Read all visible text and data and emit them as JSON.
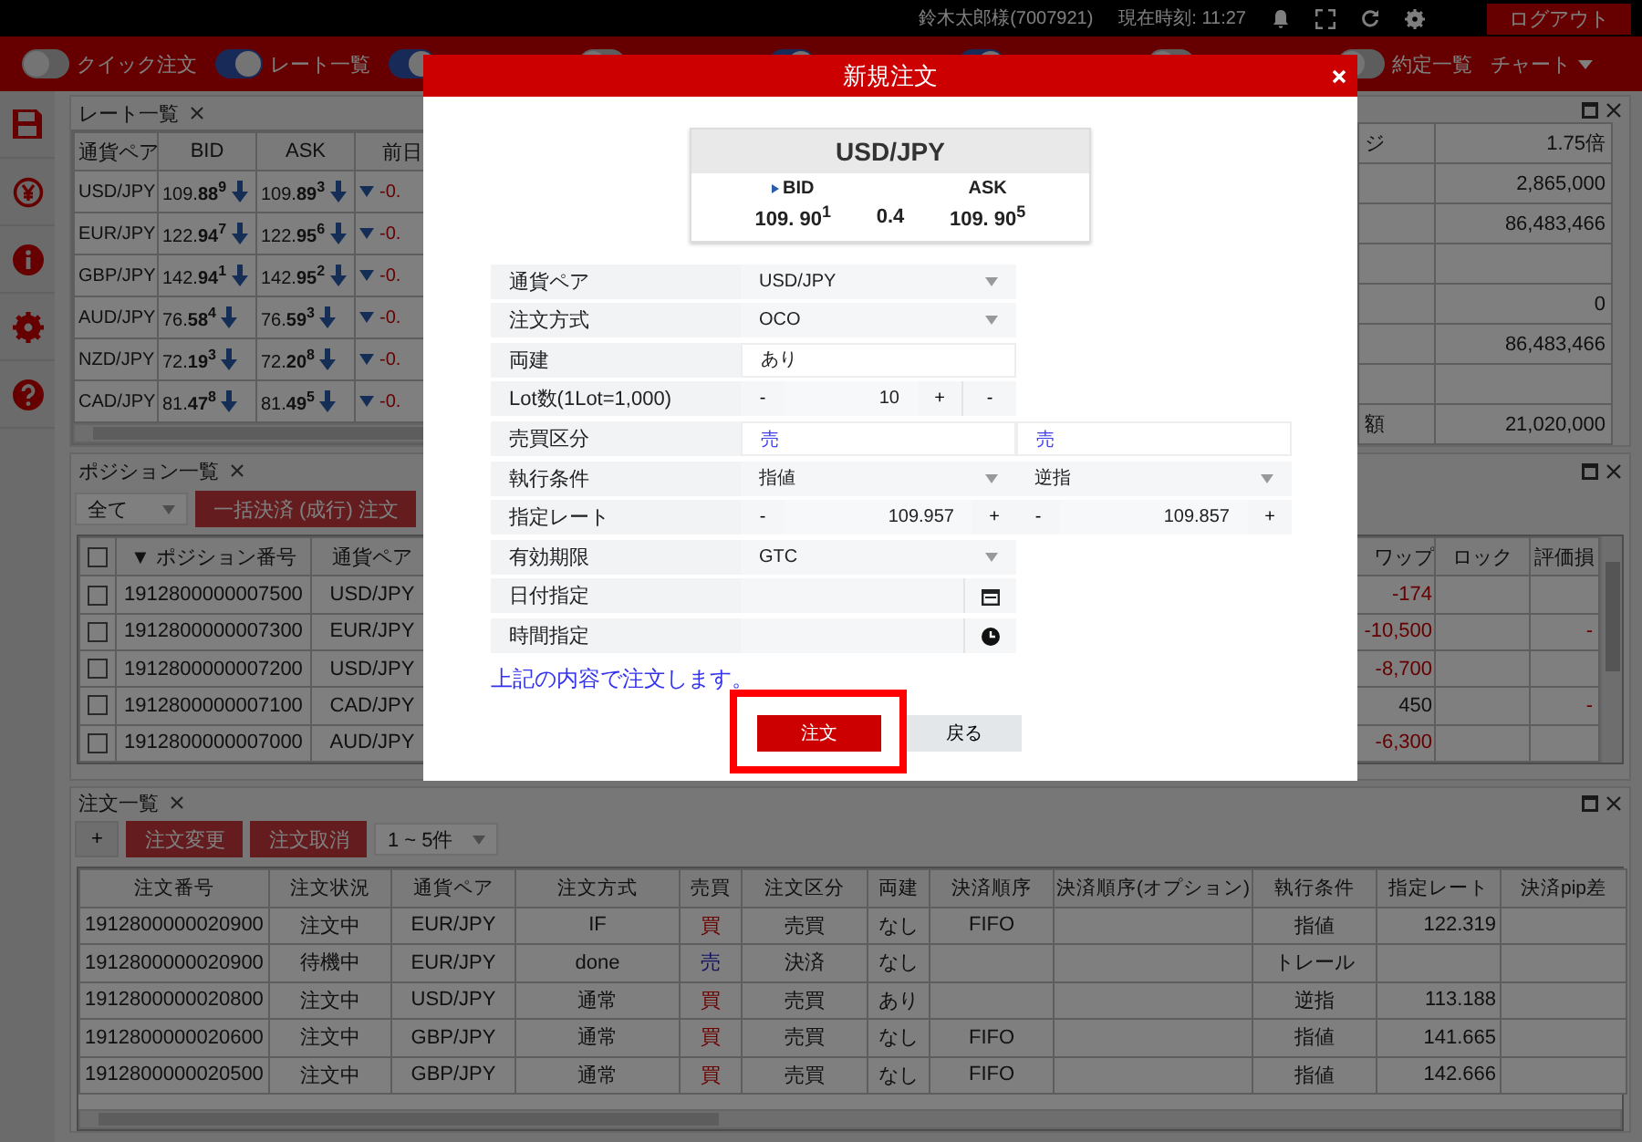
{
  "top_bar": {
    "user": "鈴木太郎様(7007921)",
    "time": "現在時刻: 11:27",
    "logout": "ログアウト"
  },
  "toolbar": {
    "toggles": [
      {
        "label": "クイック注文",
        "on": false
      },
      {
        "label": "レート一覧",
        "on": true
      },
      {
        "on": true
      },
      {
        "on": false
      },
      {
        "on": true
      },
      {
        "on": true
      },
      {
        "on": false
      },
      {
        "label": "約定一覧",
        "on": false
      }
    ],
    "menu": "チャート"
  },
  "rate_panel": {
    "tab": "レート一覧",
    "columns": [
      "通貨ペア",
      "BID",
      "ASK",
      "前日"
    ],
    "rows": [
      {
        "pair": "USD/JPY",
        "bid": "109.**88**$^{9}$",
        "ask": "109.**89**$^{3}$",
        "change": "-0."
      },
      {
        "pair": "EUR/JPY",
        "bid": "122.**94**$^{7}$",
        "ask": "122.**95**$^{6}$",
        "change": "-0."
      },
      {
        "pair": "GBP/JPY",
        "bid": "142.**94**$^{1}$",
        "ask": "142.**95**$^{2}$",
        "change": "-0."
      },
      {
        "pair": "AUD/JPY",
        "bid": "76.**58**$^{4}$",
        "ask": "76.**59**$^{3}$",
        "change": "-0."
      },
      {
        "pair": "NZD/JPY",
        "bid": "72.**19**$^{3}$",
        "ask": "72.**20**$^{8}$",
        "change": "-0."
      },
      {
        "pair": "CAD/JPY",
        "bid": "81.**47**$^{8}$",
        "ask": "81.**49**$^{5}$",
        "change": "-0."
      }
    ]
  },
  "account_panel": {
    "rows": [
      {
        "label": "ジ",
        "value": "1.75倍"
      },
      {
        "value": "2,865,000"
      },
      {
        "value": "86,483,466"
      },
      {},
      {
        "value": "0"
      },
      {
        "value": "86,483,466"
      },
      {},
      {
        "label": "額",
        "value": "21,020,000"
      }
    ]
  },
  "positions": {
    "tab": "ポジション一覧",
    "filter": "全て",
    "buttons": [
      "一括決済 (成行) 注文"
    ],
    "select_all": false,
    "columns": [
      "▼ ポジション番号",
      "通貨ペア",
      "ワップ",
      "ロック",
      "評価損"
    ],
    "rows": [
      {
        "checked": false,
        "number": "1912800000007500",
        "pair": "USD/JPY",
        "swap": {
          "text": "-174",
          "loss": true
        }
      },
      {
        "checked": false,
        "number": "1912800000007300",
        "pair": "EUR/JPY",
        "swap": {
          "text": "-10,500",
          "loss": true
        },
        "pl": "-"
      },
      {
        "checked": false,
        "number": "1912800000007200",
        "pair": "USD/JPY",
        "swap": {
          "text": "-8,700",
          "loss": true
        }
      },
      {
        "checked": false,
        "number": "1912800000007100",
        "pair": "CAD/JPY",
        "swap": {
          "text": "450",
          "loss": false
        },
        "pl": "-"
      },
      {
        "checked": false,
        "number": "1912800000007000",
        "pair": "AUD/JPY",
        "swap": {
          "text": "-6,300",
          "loss": true
        }
      }
    ]
  },
  "orders": {
    "tab": "注文一覧",
    "add": "+",
    "buttons": [
      "注文変更",
      "注文取消"
    ],
    "range": "1 ~ 5件",
    "columns": [
      "注文番号",
      "注文状況",
      "通貨ペア",
      "注文方式",
      "売買",
      "注文区分",
      "両建",
      "決済順序",
      "決済順序(オプション)",
      "執行条件",
      "指定レート",
      "決済pip差"
    ],
    "rows": [
      {
        "cells": [
          "1912800000020900",
          "注文中",
          "EUR/JPY",
          "IF",
          "買",
          "売買",
          "なし",
          "FIFO",
          "",
          "指値",
          "122.319",
          ""
        ],
        "buy": true
      },
      {
        "cells": [
          "1912800000020900",
          "待機中",
          "EUR/JPY",
          "done",
          "売",
          "決済",
          "なし",
          "",
          "",
          "トレール",
          "",
          ""
        ],
        "buy": false
      },
      {
        "cells": [
          "1912800000020800",
          "注文中",
          "USD/JPY",
          "通常",
          "買",
          "売買",
          "あり",
          "",
          "",
          "逆指",
          "113.188",
          ""
        ],
        "buy": true
      },
      {
        "cells": [
          "1912800000020600",
          "注文中",
          "GBP/JPY",
          "通常",
          "買",
          "売買",
          "なし",
          "FIFO",
          "",
          "指値",
          "141.665",
          ""
        ],
        "buy": true
      },
      {
        "cells": [
          "1912800000020500",
          "注文中",
          "GBP/JPY",
          "通常",
          "買",
          "売買",
          "なし",
          "FIFO",
          "",
          "指値",
          "142.666",
          ""
        ],
        "buy": true
      }
    ]
  },
  "modal": {
    "title": "新規注文",
    "quote": {
      "pair": "USD/JPY",
      "bid_label": "BID",
      "ask_label": "ASK",
      "bid": "109. **90**$^{1}$",
      "spread": "0.4",
      "ask": "109. **90**$^{5}$"
    },
    "form": [
      {
        "label": "通貨ペア",
        "kind": "select",
        "values": [
          "USD/JPY"
        ]
      },
      {
        "label": "注文方式",
        "kind": "select",
        "values": [
          "OCO"
        ]
      },
      {
        "label": "両建",
        "kind": "text",
        "values": [
          "あり"
        ]
      },
      {
        "label": "Lot数(1Lot=1,000)",
        "kind": "stepper",
        "parts": [
          {
            "minus": "-",
            "value": "10",
            "plus": "+",
            "extra": "-"
          }
        ]
      },
      {
        "label": "売買区分",
        "kind": "side",
        "values": [
          "売",
          "売"
        ]
      },
      {
        "label": "執行条件",
        "kind": "select",
        "values": [
          "指値",
          "逆指"
        ]
      },
      {
        "label": "指定レート",
        "kind": "stepper",
        "parts": [
          {
            "minus": "-",
            "value": "109.957",
            "plus": "+"
          },
          {
            "minus": "-",
            "value": "109.857",
            "plus": "+"
          }
        ]
      },
      {
        "label": "有効期限",
        "kind": "select",
        "values": [
          "GTC"
        ]
      },
      {
        "label": "日付指定",
        "kind": "date"
      },
      {
        "label": "時間指定",
        "kind": "time"
      }
    ],
    "confirm": "上記の内容で注文します。",
    "submit": "注文",
    "back": "戻る"
  }
}
